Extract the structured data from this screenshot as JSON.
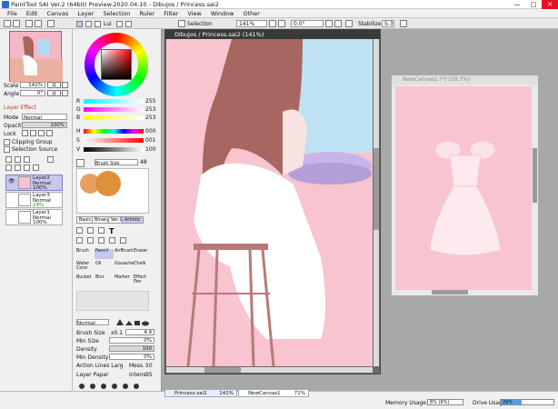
{
  "app": {
    "title": "PaintTool SAI Ver.2 (64bit) Preview.2020.04.10 - Dibujos / Princess.sai2",
    "win_minimize": "—",
    "win_maximize": "□",
    "win_close": "✕"
  },
  "menu": [
    "File",
    "Edit",
    "Canvas",
    "Layer",
    "Selection",
    "Ruler",
    "Filter",
    "View",
    "Window",
    "Other"
  ],
  "toolbar": {
    "selection_label": "Selection",
    "zoom": "141%",
    "rotation": "0.0°",
    "stabilizer_label": "Stabilizer",
    "stabilizer_value": "S-3"
  },
  "navigator": {
    "scale_label": "Scale",
    "scale_value": "141%",
    "angle_label": "Angle",
    "angle_value": "0°"
  },
  "layer_effect": {
    "section_label": "Layer Effect",
    "mode_label": "Mode",
    "mode_value": "Normal",
    "opacity_label": "Opacity",
    "opacity_value": "100%",
    "lock_label": "Lock",
    "clipping_label": "Clipping Group",
    "selection_source_label": "Selection Source"
  },
  "layers": [
    {
      "name": "Layer2",
      "mode": "Normal",
      "opacity": "100%",
      "selected": true
    },
    {
      "name": "Layer3",
      "mode": "Normal",
      "opacity": "29%",
      "selected": false
    },
    {
      "name": "Layer1",
      "mode": "Normal",
      "opacity": "100%",
      "selected": false
    }
  ],
  "color": {
    "tabs": [
      "Lui"
    ],
    "r_label": "R",
    "r_value": "255",
    "g_label": "G",
    "g_value": "253",
    "b_label": "B",
    "b_value": "253",
    "h_label": "H",
    "h_value": "000",
    "s_label": "S",
    "s_value": "001",
    "v_label": "V",
    "v_value": "100"
  },
  "brush_preview": {
    "size_label": "Brush Size",
    "size_value": "48"
  },
  "tool_tabs": [
    "Basic",
    "Binary",
    "Ver.1",
    "Artistic"
  ],
  "tools": [
    "Brush",
    "Pencil",
    "AirBrush",
    "Eraser",
    "Water Color",
    "Oil",
    "Gouache",
    "Chalk",
    "Bucket",
    "Blur",
    "Marker",
    "Effect Pen"
  ],
  "brush_settings": {
    "mode_value": "Normal",
    "brush_size_label": "Brush Size",
    "brush_size_mult": "x0.1",
    "brush_size_value": "4.9",
    "min_size_label": "Min Size",
    "min_size_value": "0%",
    "density_label": "Density",
    "density_value": "100",
    "min_density_label": "Min Density",
    "min_density_value": "0%",
    "action_lines_label": "Action Lines Larg",
    "action_lines_prefix": "Mess.",
    "action_lines_value": "50",
    "paper_label": "Layer Paper",
    "paper_prefix": "Intens.",
    "paper_value": "95"
  },
  "canvas_main": {
    "title": "Dibujos / Princess.sai2 (141%)"
  },
  "canvas_second": {
    "title": "NewCanvas1 (*) (28.7%)"
  },
  "statusbar": {
    "tab1_name": "Princess.sai2",
    "tab1_zoom": "141%",
    "tab2_name": "NewCanvas1",
    "tab2_zoom": "71%",
    "memory_label": "Memory Usage",
    "memory_value": "6% (6%)",
    "drive_label": "Drive Usage",
    "drive_value": "39%"
  },
  "colors": {
    "accent": "#c7c8ee",
    "canvas_bg": "#f7c4cf",
    "titlebar_dark": "#3a3a3a",
    "close_red": "#e81123"
  }
}
